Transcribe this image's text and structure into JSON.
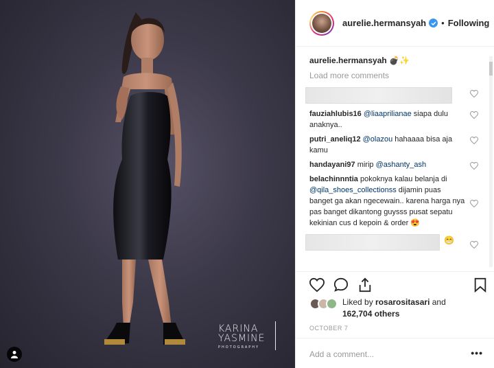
{
  "photo": {
    "watermark": {
      "line1": "KARINA",
      "line2": "YASMINE",
      "line3": "PHOTOGRAPHY"
    },
    "user_tag_icon": "person-icon"
  },
  "header": {
    "username": "aurelie.hermansyah",
    "verified_icon": "verified-badge-icon",
    "separator": "•",
    "follow_state": "Following"
  },
  "caption": {
    "username": "aurelie.hermansyah",
    "emoji": "💣✨"
  },
  "load_more": "Load more comments",
  "comments": [
    {
      "user": "fauziahlubis16",
      "mention": "@liaaprilianae",
      "text": " siapa dulu anaknya.."
    },
    {
      "user": "putri_aneliq12",
      "mention": "@olazou",
      "text": " hahaaaa bisa aja kamu"
    },
    {
      "user": "handayani97",
      "pre": " mirip ",
      "mention": "@ashanty_ash",
      "text": ""
    },
    {
      "user": "belachinnntia",
      "pre": " pokoknya kalau belanja di ",
      "mention": "@qila_shoes_collectionss",
      "text": " dijamin puas banget ga akan ngecewain.. karena harga nya pas banget dikantong guysss pusat sepatu kekinian cus d kepoin & order 😍"
    }
  ],
  "blurred_emoji": "😁",
  "likes": {
    "prefix": "Liked by ",
    "user": "rosarositasari",
    "and": " and ",
    "count": "162,704 others"
  },
  "date": "OCTOBER 7",
  "add_comment_placeholder": "Add a comment...",
  "more_label": "•••",
  "colors": {
    "accent": "#3897f0",
    "link": "#003569",
    "muted": "#999999",
    "text": "#262626"
  }
}
